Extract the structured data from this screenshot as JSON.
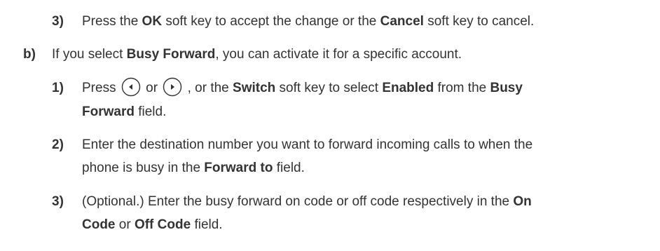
{
  "item_prev_3": {
    "number": "3)",
    "p1": "Press the ",
    "b1": "OK",
    "p2": " soft key to accept the change or the ",
    "b2": "Cancel",
    "p3": " soft key to cancel."
  },
  "item_b": {
    "letter": "b)",
    "p1": "If you select ",
    "b1": "Busy Forward",
    "p2": ", you can activate it for a specific account."
  },
  "steps": [
    {
      "number": "1)",
      "line1": {
        "p1": "Press ",
        "or": " or ",
        "p2": " , or the ",
        "b1": "Switch",
        "p3": " soft key to select ",
        "b2": "Enabled",
        "p4": " from the ",
        "b3": "Busy"
      },
      "line2": {
        "b1": "Forward",
        "p1": " field."
      }
    },
    {
      "number": "2)",
      "line1": {
        "p1": "Enter the destination number you want to forward incoming calls to when the"
      },
      "line2": {
        "p1": "phone is busy in the ",
        "b1": "Forward to",
        "p2": " field."
      }
    },
    {
      "number": "3)",
      "line1": {
        "p1": "(Optional.) Enter the busy forward on code or off code respectively in the ",
        "b1": "On"
      },
      "line2": {
        "b1": "Code",
        "p1": " or ",
        "b2": "Off Code",
        "p2": " field."
      }
    }
  ],
  "icons": {
    "left": "left-arrow-key-icon",
    "right": "right-arrow-key-icon"
  }
}
